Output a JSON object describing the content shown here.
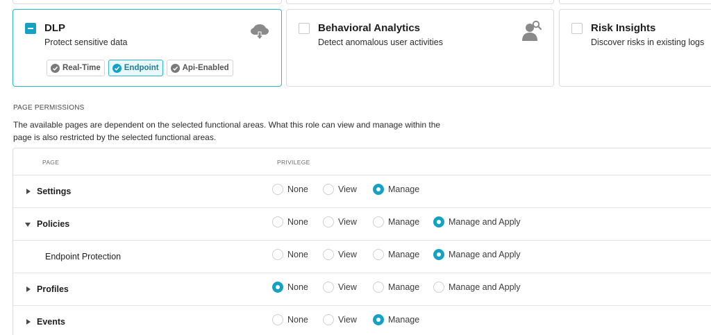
{
  "cards": [
    {
      "title": "DLP",
      "description": "Protect sensitive data",
      "selected": true,
      "icon": "cloud-download-icon",
      "tags": [
        {
          "label": "Real-Time",
          "active": false
        },
        {
          "label": "Endpoint",
          "active": true
        },
        {
          "label": "Api-Enabled",
          "active": false
        }
      ]
    },
    {
      "title": "Behavioral Analytics",
      "description": "Detect anomalous user activities",
      "selected": false,
      "icon": "user-search-icon"
    },
    {
      "title": "Risk Insights",
      "description": "Discover risks in existing logs",
      "selected": false
    }
  ],
  "permissions": {
    "heading": "PAGE PERMISSIONS",
    "description": "The available pages are dependent on the selected functional areas. What this role can view and manage within the page is also restricted by the selected functional areas.",
    "col_page": "PAGE",
    "col_privilege": "PRIVILEGE",
    "rows": [
      {
        "name": "Settings",
        "expanded": false,
        "options": [
          "None",
          "View",
          "Manage"
        ],
        "selected": "Manage"
      },
      {
        "name": "Policies",
        "expanded": true,
        "options": [
          "None",
          "View",
          "Manage",
          "Manage and Apply"
        ],
        "selected": "Manage and Apply"
      },
      {
        "name": "Endpoint Protection",
        "child": true,
        "options": [
          "None",
          "View",
          "Manage",
          "Manage and Apply"
        ],
        "selected": "Manage and Apply"
      },
      {
        "name": "Profiles",
        "expanded": false,
        "options": [
          "None",
          "View",
          "Manage",
          "Manage and Apply"
        ],
        "selected": "None"
      },
      {
        "name": "Events",
        "expanded": false,
        "options": [
          "None",
          "View",
          "Manage"
        ],
        "selected": "Manage"
      }
    ]
  },
  "colors": {
    "accent": "#14a2c4",
    "border": "#dcdcdc"
  }
}
